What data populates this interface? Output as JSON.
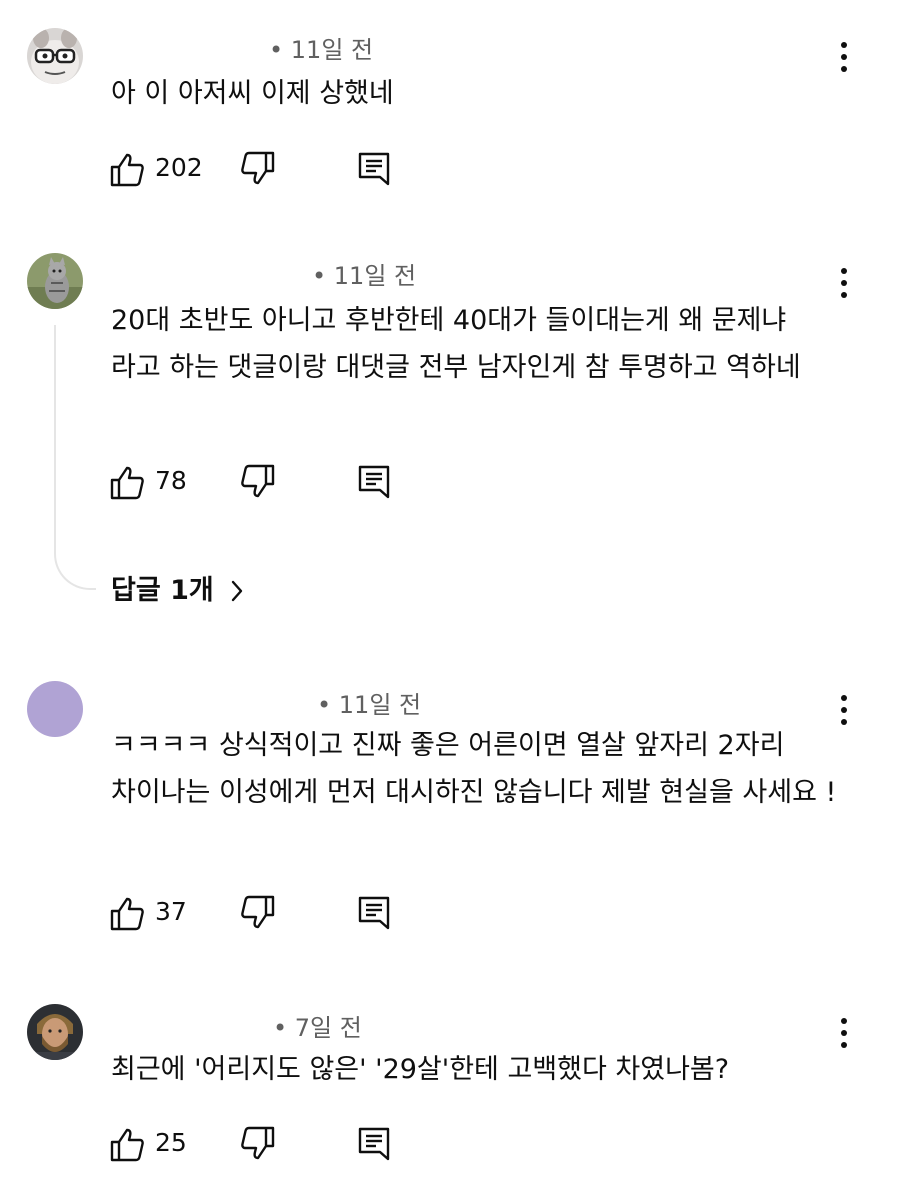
{
  "comments": [
    {
      "time": "• 11일 전",
      "text": "아 이 아저씨 이제 상했네",
      "likes": "202",
      "avatar_icon": "masked-face-avatar"
    },
    {
      "time": "• 11일 전",
      "text": "20대 초반도 아니고 후반한테 40대가 들이대는게 왜 문제냐 라고 하는 댓글이랑 대댓글 전부 남자인게 참 투명하고 역하네",
      "likes": "78",
      "avatar_icon": "cat-photo-avatar",
      "replies_label": "답글 1개"
    },
    {
      "time": "• 11일 전",
      "text": "ㅋㅋㅋㅋ 상식적이고 진짜 좋은 어른이면 열살 앞자리 2자리 차이나는 이성에게 먼저 대시하진 않습니다 제발 현실을 사세요 !",
      "likes": "37",
      "avatar_icon": "purple-circle-avatar",
      "avatar_color": "#b0a3d4"
    },
    {
      "time": "• 7일 전",
      "text": "최근에 '어리지도 않은' '29살'한테 고백했다 차였나봄?",
      "likes": "25",
      "avatar_icon": "bearded-man-avatar"
    }
  ],
  "icons": {
    "like": "thumbs-up-icon",
    "dislike": "thumbs-down-icon",
    "reply": "reply-icon",
    "menu": "more-vertical-icon",
    "chevron": "chevron-right-icon"
  },
  "colors": {
    "text": "#0f0f0f",
    "meta": "#606060",
    "thread_line": "#e5e5e5"
  }
}
